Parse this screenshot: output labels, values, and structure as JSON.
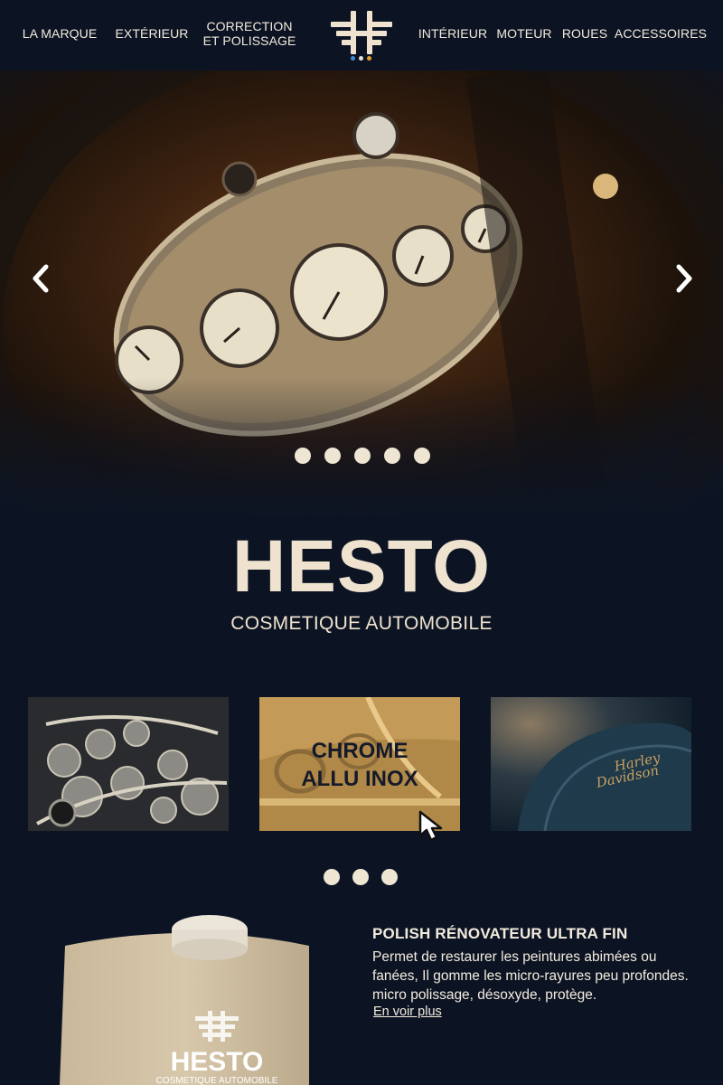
{
  "nav": {
    "items": [
      {
        "label": "LA MARQUE"
      },
      {
        "label": "EXTÉRIEUR"
      },
      {
        "label": "CORRECTION\nET POLISSAGE"
      },
      {
        "label": "INTÉRIEUR"
      },
      {
        "label": "MOTEUR"
      },
      {
        "label": "ROUES"
      },
      {
        "label": "ACCESSOIRES"
      }
    ],
    "logo_dot_colors": [
      "#3d8fd1",
      "#e9e2d4",
      "#e0a42a"
    ]
  },
  "hero": {
    "slide_count": 5,
    "prev_icon": "chevron-left-icon",
    "next_icon": "chevron-right-icon"
  },
  "brand": {
    "title": "HESTO",
    "subtitle": "COSMETIQUE AUTOMOBILE"
  },
  "cards": [
    {
      "image": "engine"
    },
    {
      "image": "classic-car-chrome",
      "line1": "CHROME",
      "line2": "ALLU INOX"
    },
    {
      "image": "motorcycle-tank",
      "image_text": "Harley Davidson"
    }
  ],
  "carousel_dots": 3,
  "product": {
    "title": "POLISH RÉNOVATEUR ULTRA FIN",
    "description": "Permet de restaurer les peintures abimées ou fanées, Il gomme les micro-rayures peu profondes. micro polissage, désoxyde, protège.",
    "link": "En voir plus",
    "can_brand": "HESTO",
    "can_sub": "COSMETIQUE AUTOMOBILE"
  },
  "colors": {
    "background": "#0c1424",
    "text": "#f0e6d6",
    "accent_gold": "#c39a58"
  }
}
